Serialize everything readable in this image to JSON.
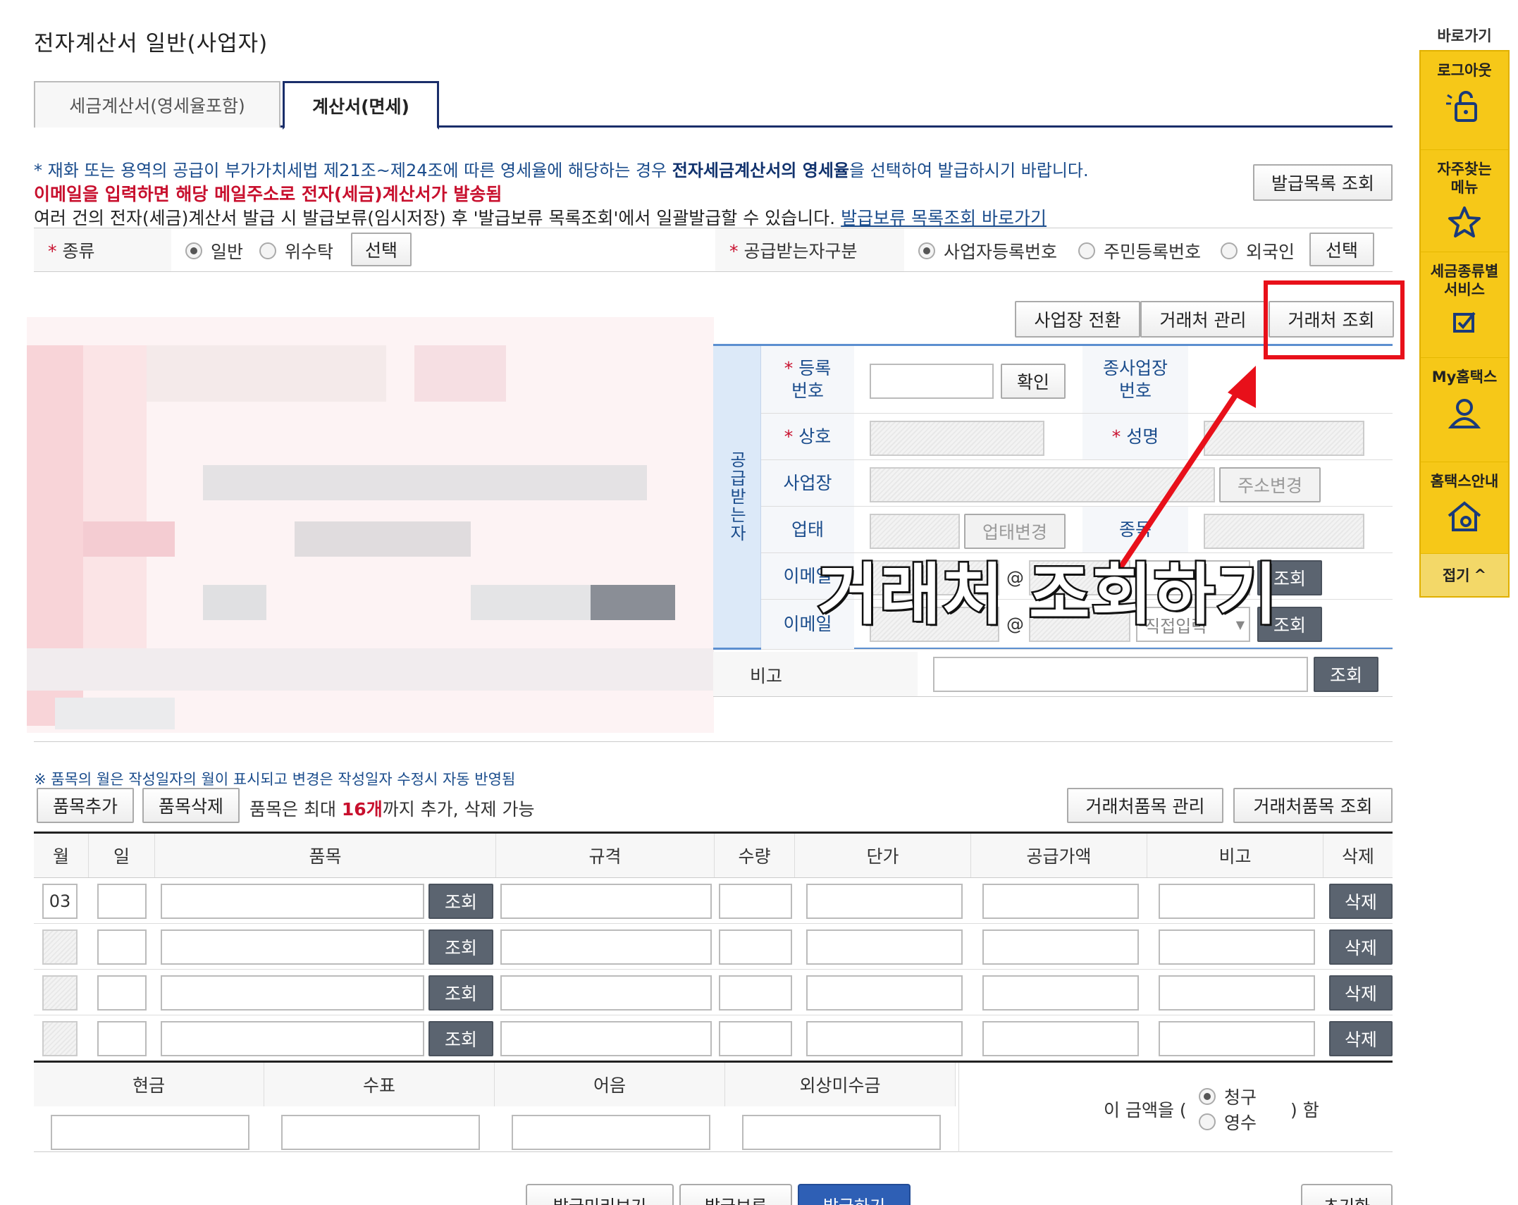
{
  "page": {
    "title": "전자계산서 일반(사업자)"
  },
  "tabs": [
    {
      "label": "세금계산서(영세율포함)"
    },
    {
      "label": "계산서(면세)"
    }
  ],
  "notes": {
    "n1_prefix": "* 재화 또는 용역의 공급이 부가가치세법 제21조~제24조에 따른 영세율에 해당하는 경우 ",
    "n1_bold": "전자세금계산서의 영세율",
    "n1_suffix": "을 선택하여 발급하시기 바랍니다.",
    "n2": "이메일을 입력하면 해당 메일주소로 전자(세금)계산서가 발송됨",
    "n3": "여러 건의 전자(세금)계산서 발급 시 발급보류(임시저장) 후 '발급보류 목록조회'에서 일괄발급할 수 있습니다.",
    "n3_link": "발급보류 목록조회 바로가기"
  },
  "buttons": {
    "issue_list": "발급목록 조회",
    "select": "선택",
    "switch_biz": "사업장 전환",
    "partner_manage": "거래처 관리",
    "partner_search": "거래처 조회",
    "confirm": "확인",
    "addr_change": "주소변경",
    "biztype_change": "업태변경",
    "lookup": "조회",
    "item_add": "품목추가",
    "item_delete": "품목삭제",
    "partner_item_manage": "거래처품목 관리",
    "partner_item_search": "거래처품목 조회",
    "delete": "삭제",
    "preview": "발급미리보기",
    "hold": "발급보류",
    "issue": "발급하기",
    "reset": "초기화"
  },
  "type_row": {
    "label": "종류",
    "options": [
      "일반",
      "위수탁"
    ],
    "receiver_label": "공급받는자구분",
    "receiver_options": [
      "사업자등록번호",
      "주민등록번호",
      "외국인"
    ]
  },
  "receiver": {
    "side_label": "공급받는자",
    "reg_no": "등록\n번호",
    "reg_no_l1": "등록",
    "reg_no_l2": "번호",
    "sub_biz_l1": "종사업장",
    "sub_biz_l2": "번호",
    "company": "상호",
    "name": "성명",
    "address": "사업장",
    "biz_type": "업태",
    "biz_item": "종목",
    "email": "이메일",
    "at": "@",
    "direct_input": "직접입력",
    "memo": "비고"
  },
  "annotation": {
    "text": "거래처 조회하기"
  },
  "items": {
    "note": "※ 품목의 월은 작성일자의 월이 표시되고 변경은 작성일자 수정시 자동 반영됨",
    "limit_prefix": "품목은 최대 ",
    "limit_count": "16개",
    "limit_suffix": "까지 추가, 삭제 가능",
    "headers": [
      "월",
      "일",
      "품목",
      "규격",
      "수량",
      "단가",
      "공급가액",
      "비고",
      "삭제"
    ],
    "first_month": "03"
  },
  "payment": {
    "headers": [
      "현금",
      "수표",
      "어음",
      "외상미수금"
    ],
    "prefix": "이 금액을 (",
    "options": [
      "청구",
      "영수"
    ],
    "suffix": ") 함"
  },
  "sidebar": {
    "title": "바로가기",
    "items": [
      {
        "label": "로그아웃",
        "icon": "lock-icon"
      },
      {
        "label": "자주찾는\n메뉴",
        "l1": "자주찾는",
        "l2": "메뉴",
        "icon": "star-icon"
      },
      {
        "label": "세금종류별\n서비스",
        "l1": "세금종류별",
        "l2": "서비스",
        "icon": "check-icon"
      },
      {
        "label": "My홈택스",
        "icon": "user-icon"
      },
      {
        "label": "홈택스안내",
        "icon": "home-icon"
      }
    ],
    "fold": "접기"
  },
  "colors": {
    "navy": "#1a2e6a",
    "accent_red": "#e8101a",
    "sidebar_yellow": "#f6c818",
    "link_blue": "#1a4c8c"
  }
}
